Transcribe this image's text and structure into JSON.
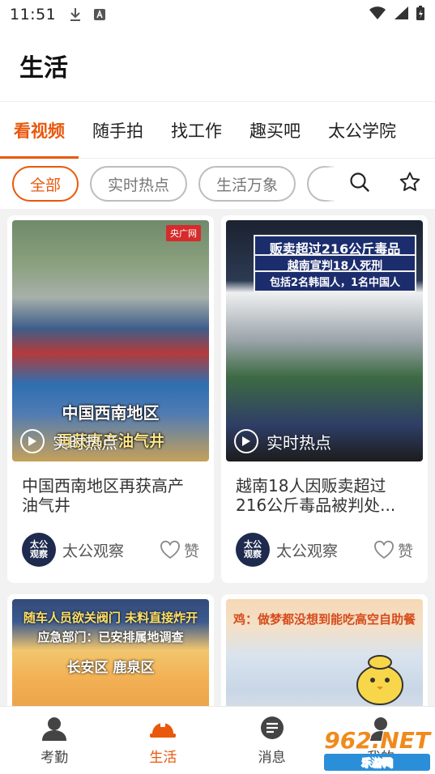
{
  "status_bar": {
    "time": "11:51"
  },
  "header": {
    "title": "生活"
  },
  "tabs": [
    {
      "label": "看视频",
      "active": true
    },
    {
      "label": "随手拍",
      "active": false
    },
    {
      "label": "找工作",
      "active": false
    },
    {
      "label": "趣买吧",
      "active": false
    },
    {
      "label": "太公学院",
      "active": false
    }
  ],
  "filters": [
    {
      "label": "全部",
      "active": true
    },
    {
      "label": "实时热点",
      "active": false
    },
    {
      "label": "生活万象",
      "active": false
    }
  ],
  "cards": [
    {
      "overlay_line1": "中国西南地区",
      "overlay_line2": "再获高产油气井",
      "badge": "央广网",
      "tag": "实时热点",
      "title": "中国西南地区再获高产油气井",
      "author": "太公观察",
      "avatar_text": "太公观察",
      "like_label": "赞"
    },
    {
      "banner1": "贩卖超过216公斤毒品",
      "banner2": "越南宣判18人死刑",
      "banner3": "包括2名韩国人，1名中国人",
      "tag": "实时热点",
      "title": "越南18人因贩卖超过216公斤毒品被判处...",
      "author": "太公观察",
      "avatar_text": "太公观察",
      "like_label": "赞"
    },
    {
      "overlay_line1": "随车人员欲关阀门 未料直接炸开",
      "overlay_line2": "应急部门：已安排属地调查",
      "overlay_line3": "长安区 鹿泉区"
    },
    {
      "overlay_line1": "鸡：做梦都没想到能吃高空自助餐"
    }
  ],
  "bottom_nav": [
    {
      "label": "考勤",
      "icon": "person-icon",
      "active": false
    },
    {
      "label": "生活",
      "icon": "helmet-icon",
      "active": true
    },
    {
      "label": "消息",
      "icon": "message-icon",
      "active": false
    },
    {
      "label": "我的",
      "icon": "profile-icon",
      "active": false
    }
  ],
  "watermark": {
    "brand": "962.NET",
    "sub": "乐游网"
  },
  "colors": {
    "accent": "#e9580c",
    "avatar_bg": "#1e2a4e"
  }
}
